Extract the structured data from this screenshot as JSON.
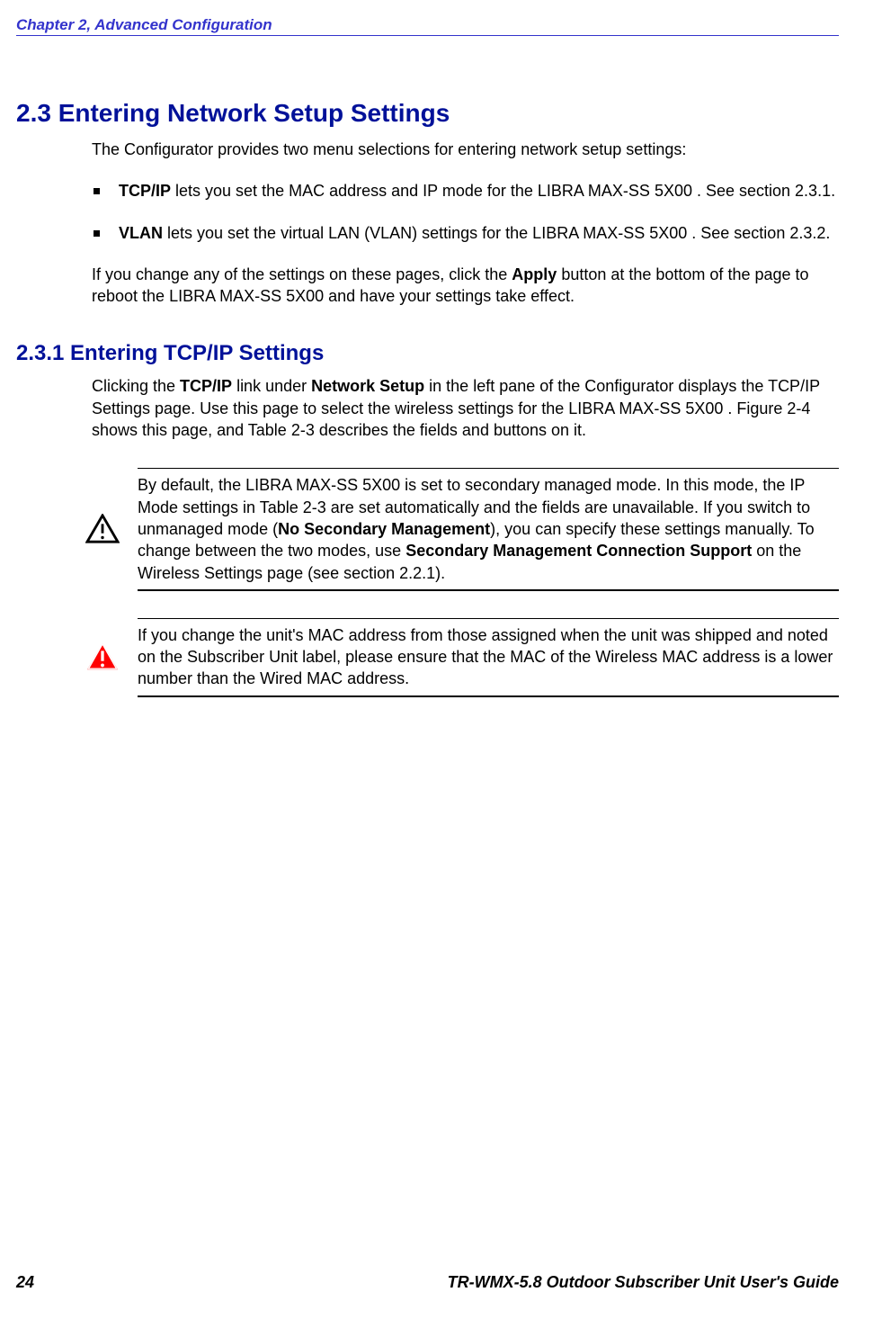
{
  "header": {
    "chapter": "Chapter 2, Advanced Configuration"
  },
  "section23": {
    "title": "2.3 Entering Network Setup Settings",
    "intro": "The Configurator provides two menu selections for entering network setup settings:",
    "bullets": [
      {
        "bold": "TCP/IP",
        "text": " lets you set the MAC address and IP mode for the LIBRA MAX-SS 5X00 . See section 2.3.1."
      },
      {
        "bold": "VLAN",
        "text": " lets you set the virtual LAN (VLAN) settings for the LIBRA MAX-SS 5X00 . See section 2.3.2."
      }
    ],
    "para2_a": "If you change any of the settings on these pages, click the ",
    "para2_bold": "Apply",
    "para2_b": " button at the bottom of the page to reboot the LIBRA MAX-SS 5X00  and have your settings take effect."
  },
  "section231": {
    "title": "2.3.1 Entering TCP/IP Settings",
    "para_a": "Clicking the ",
    "para_bold1": "TCP/IP",
    "para_b": " link under ",
    "para_bold2": "Network Setup",
    "para_c": " in the left pane of the Configurator displays the TCP/IP Settings page. Use this page to select the wireless settings for the LIBRA MAX-SS 5X00 . Figure 2-4 shows this page, and Table 2-3 describes the fields and buttons on it."
  },
  "note1": {
    "a": "By default, the LIBRA MAX-SS 5X00  is set to secondary managed mode. In this mode, the IP Mode settings in Table 2-3 are set automatically and the fields are unavailable. If you switch to unmanaged mode (",
    "bold1": "No Secondary Management",
    "b": "), you can specify these settings manually. To change between the two modes, use ",
    "bold2": "Secondary Management Connection Support",
    "c": " on the Wireless Settings page (see section 2.2.1)."
  },
  "note2": {
    "text": "If you change the unit's MAC address from those assigned when the unit was shipped and noted on the Subscriber Unit label, please ensure that the MAC of the Wireless MAC address is a lower number than the Wired MAC address."
  },
  "footer": {
    "left": "24",
    "right": "TR-WMX-5.8 Outdoor Subscriber Unit User's Guide"
  }
}
